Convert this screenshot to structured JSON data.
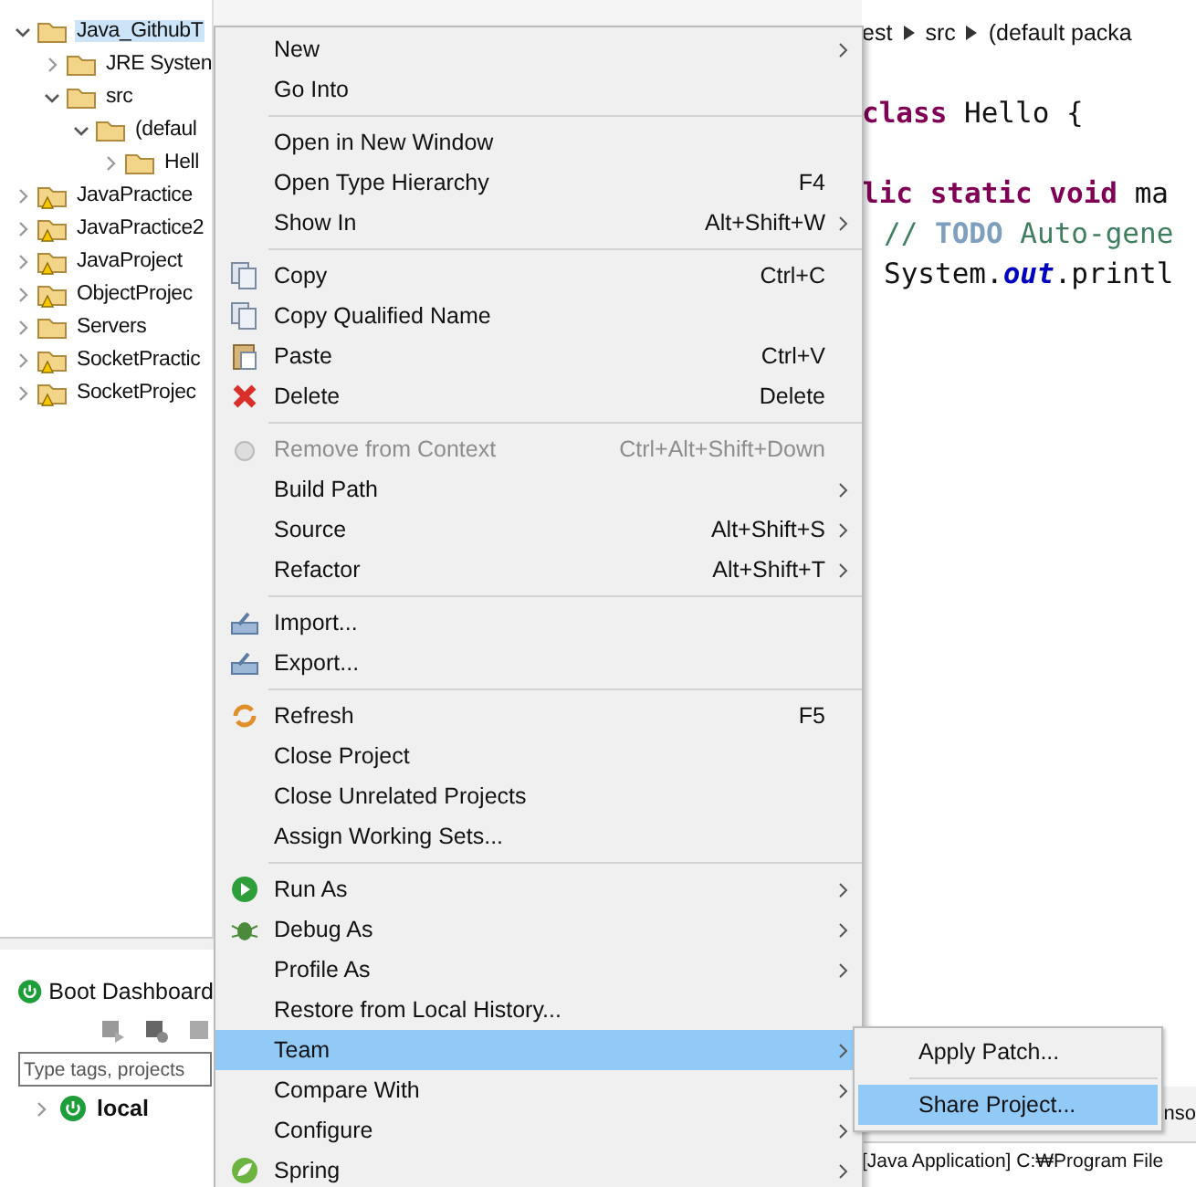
{
  "project_tree": [
    {
      "label": "Java_GithubT",
      "expanded": true,
      "selected": true,
      "warning": false,
      "children": [
        {
          "label": "JRE Systen",
          "expanded": false,
          "selected": false,
          "warning": false
        },
        {
          "label": "src",
          "expanded": true,
          "selected": false,
          "warning": false,
          "children": [
            {
              "label": "(defaul",
              "expanded": true,
              "selected": false,
              "warning": false,
              "children": [
                {
                  "label": "Hell",
                  "expanded": false,
                  "selected": false,
                  "warning": false
                }
              ]
            }
          ]
        }
      ]
    },
    {
      "label": "JavaPractice",
      "expanded": false,
      "selected": false,
      "warning": true
    },
    {
      "label": "JavaPractice2",
      "expanded": false,
      "selected": false,
      "warning": true
    },
    {
      "label": "JavaProject",
      "expanded": false,
      "selected": false,
      "warning": true
    },
    {
      "label": "ObjectProjec",
      "expanded": false,
      "selected": false,
      "warning": true
    },
    {
      "label": "Servers",
      "expanded": false,
      "selected": false,
      "warning": false
    },
    {
      "label": "SocketPractic",
      "expanded": false,
      "selected": false,
      "warning": true
    },
    {
      "label": "SocketProjec",
      "expanded": false,
      "selected": false,
      "warning": true
    }
  ],
  "boot_dashboard": {
    "title": "Boot Dashboard",
    "search": {
      "placeholder": "Type tags, projects"
    },
    "items": [
      {
        "label": "local",
        "expanded": false
      }
    ]
  },
  "editor": {
    "breadcrumb": [
      "est",
      "src",
      "(default packa"
    ],
    "code": [
      {
        "indent": false,
        "segments": [
          {
            "kind": "keyword",
            "text": "class"
          },
          {
            "kind": "plain",
            "text": " Hello {"
          }
        ]
      },
      {
        "indent": false,
        "segments": [
          {
            "kind": "keyword",
            "text": "lic static void"
          },
          {
            "kind": "plain",
            "text": " ma"
          }
        ]
      },
      {
        "indent": true,
        "segments": [
          {
            "kind": "comment",
            "text": "// "
          },
          {
            "kind": "todo",
            "text": "TODO"
          },
          {
            "kind": "comment",
            "text": " Auto-gene"
          }
        ]
      },
      {
        "indent": true,
        "segments": [
          {
            "kind": "plain",
            "text": "System."
          },
          {
            "kind": "field",
            "text": "out"
          },
          {
            "kind": "plain",
            "text": ".printl"
          }
        ]
      }
    ],
    "console_tab": "nso",
    "console_line": "[Java Application] C:₩Program File"
  },
  "context_menu": [
    {
      "kind": "item",
      "label": "New",
      "submenu": true,
      "disabled": false,
      "selected": false
    },
    {
      "kind": "item",
      "label": "Go Into",
      "submenu": false,
      "disabled": false,
      "selected": false
    },
    {
      "kind": "separator"
    },
    {
      "kind": "item",
      "label": "Open in New Window",
      "submenu": false,
      "disabled": false,
      "selected": false
    },
    {
      "kind": "item",
      "label": "Open Type Hierarchy",
      "shortcut": "F4",
      "submenu": false,
      "disabled": false,
      "selected": false
    },
    {
      "kind": "item",
      "label": "Show In",
      "shortcut": "Alt+Shift+W",
      "submenu": true,
      "disabled": false,
      "selected": false
    },
    {
      "kind": "separator"
    },
    {
      "kind": "item",
      "label": "Copy",
      "shortcut": "Ctrl+C",
      "submenu": false,
      "disabled": false,
      "selected": false
    },
    {
      "kind": "item",
      "label": "Copy Qualified Name",
      "submenu": false,
      "disabled": false,
      "selected": false
    },
    {
      "kind": "item",
      "label": "Paste",
      "shortcut": "Ctrl+V",
      "submenu": false,
      "disabled": false,
      "selected": false
    },
    {
      "kind": "item",
      "label": "Delete",
      "shortcut": "Delete",
      "submenu": false,
      "disabled": false,
      "selected": false
    },
    {
      "kind": "separator"
    },
    {
      "kind": "item",
      "label": "Remove from Context",
      "shortcut": "Ctrl+Alt+Shift+Down",
      "submenu": false,
      "disabled": true,
      "selected": false
    },
    {
      "kind": "item",
      "label": "Build Path",
      "submenu": true,
      "disabled": false,
      "selected": false
    },
    {
      "kind": "item",
      "label": "Source",
      "shortcut": "Alt+Shift+S",
      "submenu": true,
      "disabled": false,
      "selected": false
    },
    {
      "kind": "item",
      "label": "Refactor",
      "shortcut": "Alt+Shift+T",
      "submenu": true,
      "disabled": false,
      "selected": false
    },
    {
      "kind": "separator"
    },
    {
      "kind": "item",
      "label": "Import...",
      "submenu": false,
      "disabled": false,
      "selected": false
    },
    {
      "kind": "item",
      "label": "Export...",
      "submenu": false,
      "disabled": false,
      "selected": false
    },
    {
      "kind": "separator"
    },
    {
      "kind": "item",
      "label": "Refresh",
      "shortcut": "F5",
      "submenu": false,
      "disabled": false,
      "selected": false
    },
    {
      "kind": "item",
      "label": "Close Project",
      "submenu": false,
      "disabled": false,
      "selected": false
    },
    {
      "kind": "item",
      "label": "Close Unrelated Projects",
      "submenu": false,
      "disabled": false,
      "selected": false
    },
    {
      "kind": "item",
      "label": "Assign Working Sets...",
      "submenu": false,
      "disabled": false,
      "selected": false
    },
    {
      "kind": "separator"
    },
    {
      "kind": "item",
      "label": "Run As",
      "submenu": true,
      "disabled": false,
      "selected": false
    },
    {
      "kind": "item",
      "label": "Debug As",
      "submenu": true,
      "disabled": false,
      "selected": false
    },
    {
      "kind": "item",
      "label": "Profile As",
      "submenu": true,
      "disabled": false,
      "selected": false
    },
    {
      "kind": "item",
      "label": "Restore from Local History...",
      "submenu": false,
      "disabled": false,
      "selected": false
    },
    {
      "kind": "item",
      "label": "Team",
      "submenu": true,
      "disabled": false,
      "selected": true
    },
    {
      "kind": "item",
      "label": "Compare With",
      "submenu": true,
      "disabled": false,
      "selected": false
    },
    {
      "kind": "item",
      "label": "Configure",
      "submenu": true,
      "disabled": false,
      "selected": false
    },
    {
      "kind": "item",
      "label": "Spring",
      "submenu": true,
      "disabled": false,
      "selected": false
    }
  ],
  "team_submenu": [
    {
      "kind": "item",
      "label": "Apply Patch...",
      "selected": false
    },
    {
      "kind": "separator"
    },
    {
      "kind": "item",
      "label": "Share Project...",
      "selected": true
    }
  ]
}
